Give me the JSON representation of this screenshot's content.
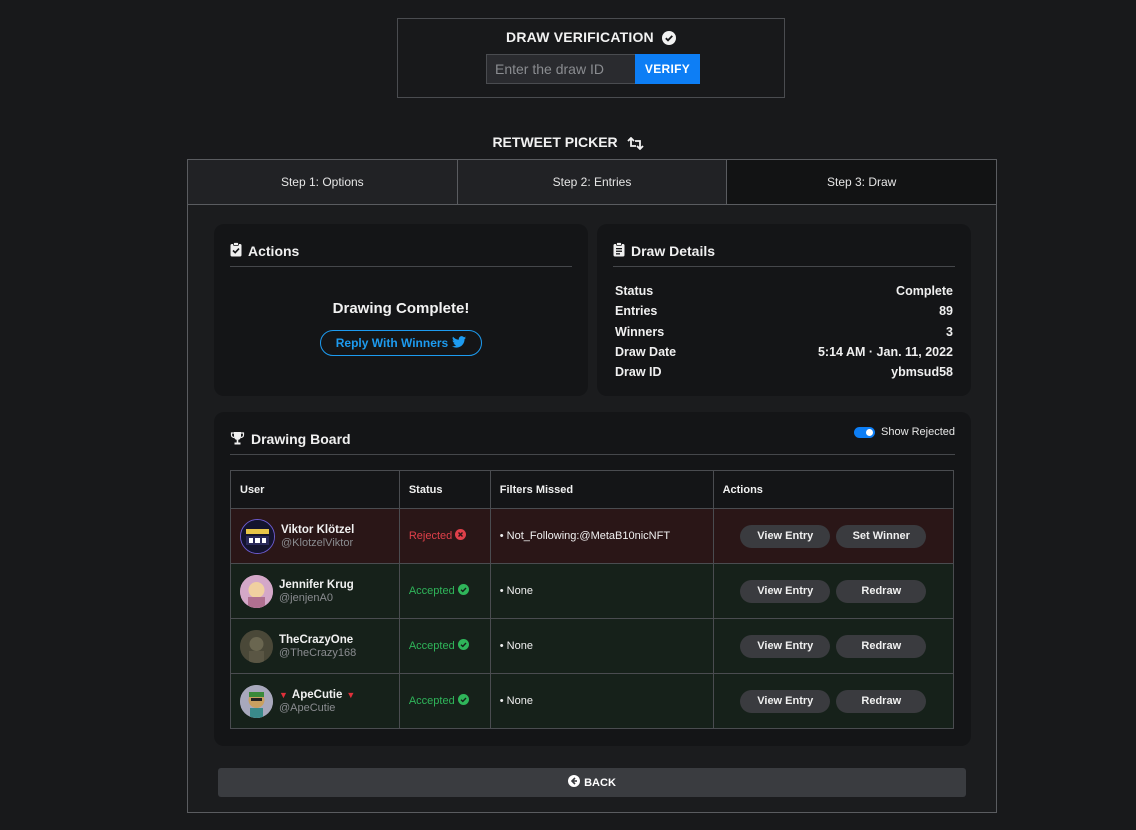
{
  "verification": {
    "title": "DRAW VERIFICATION",
    "input_placeholder": "Enter the draw ID",
    "verify_label": "VERIFY"
  },
  "picker": {
    "title": "RETWEET PICKER",
    "steps": [
      "Step 1: Options",
      "Step 2: Entries",
      "Step 3: Draw"
    ],
    "active_step": 3
  },
  "actions": {
    "title": "Actions",
    "message": "Drawing Complete!",
    "reply_label": "Reply With Winners"
  },
  "draw_details": {
    "title": "Draw Details",
    "rows": [
      {
        "label": "Status",
        "value": "Complete"
      },
      {
        "label": "Entries",
        "value": "89"
      },
      {
        "label": "Winners",
        "value": "3"
      },
      {
        "label": "Draw Date",
        "value": "5:14 AM · Jan. 11, 2022"
      },
      {
        "label": "Draw ID",
        "value": "ybmsud58"
      }
    ]
  },
  "board": {
    "title": "Drawing Board",
    "toggle_label": "Show Rejected",
    "toggle_on": true,
    "columns": [
      "User",
      "Status",
      "Filters Missed",
      "Actions"
    ],
    "rows": [
      {
        "name": "Viktor Klötzel",
        "handle": "@KlotzelViktor",
        "status": "Rejected",
        "filters": "• Not_Following:@MetaB10nicNFT",
        "action1": "View Entry",
        "action2": "Set Winner"
      },
      {
        "name": "Jennifer Krug",
        "handle": "@jenjenA0",
        "status": "Accepted",
        "filters": "• None",
        "action1": "View Entry",
        "action2": "Redraw"
      },
      {
        "name": "TheCrazyOne",
        "handle": "@TheCrazy168",
        "status": "Accepted",
        "filters": "• None",
        "action1": "View Entry",
        "action2": "Redraw"
      },
      {
        "name": "ApeCutie",
        "handle": "@ApeCutie",
        "status": "Accepted",
        "filters": "• None",
        "action1": "View Entry",
        "action2": "Redraw"
      }
    ]
  },
  "back_label": "BACK",
  "colors": {
    "accent": "#0d7ef5",
    "twitter": "#1d9bf0",
    "rejected": "#e0404a",
    "accepted": "#2fb55a"
  }
}
